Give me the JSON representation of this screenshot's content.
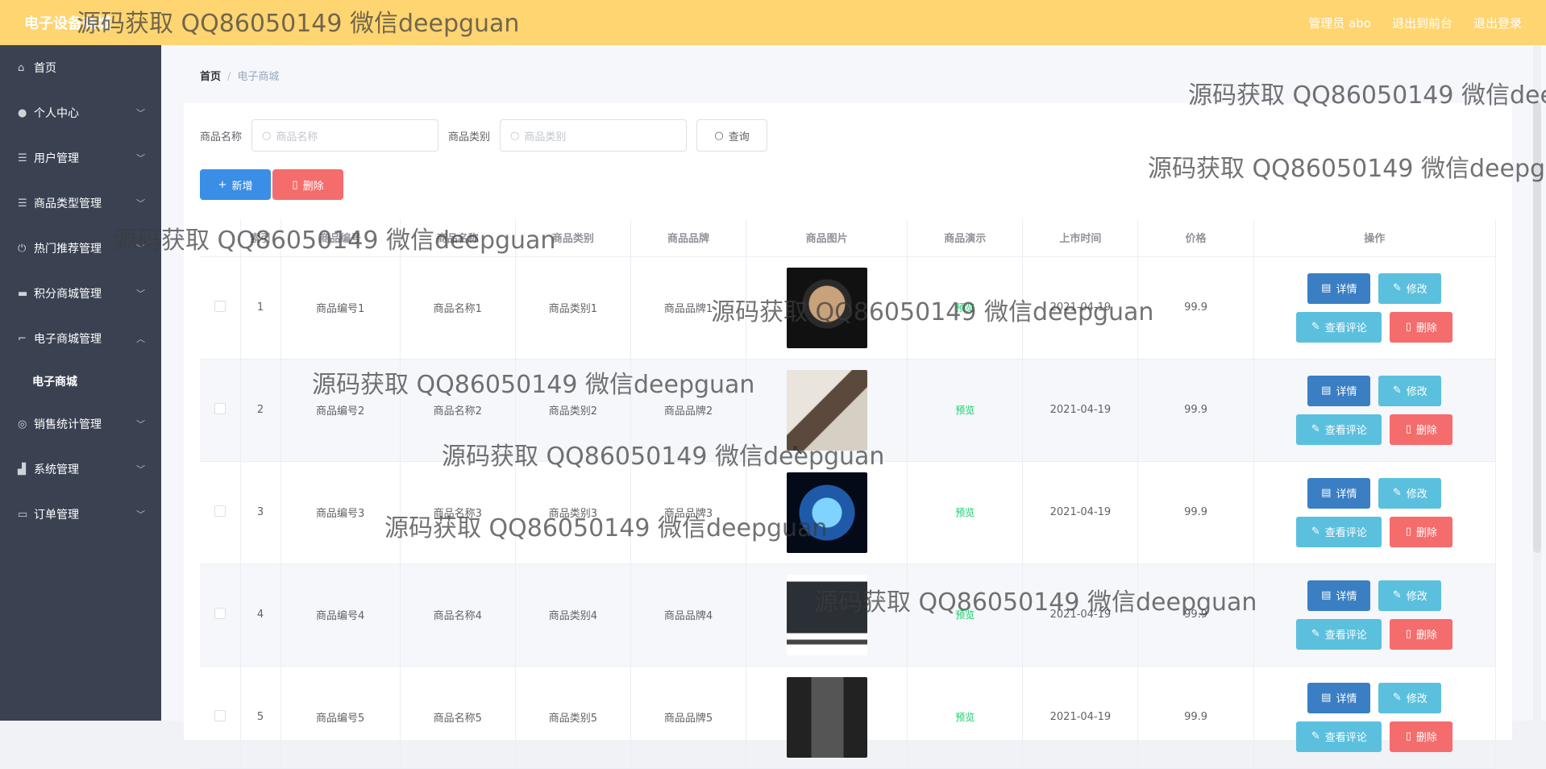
{
  "header": {
    "title": "电子设备商城",
    "admin_label": "管理员 abo",
    "front_link": "退出到前台",
    "logout_link": "退出登录"
  },
  "sidebar": {
    "items": [
      {
        "label": "首页",
        "icon": "home-icon"
      },
      {
        "label": "个人中心",
        "icon": "user-icon"
      },
      {
        "label": "用户管理",
        "icon": "menu-icon"
      },
      {
        "label": "商品类型管理",
        "icon": "menu-icon"
      },
      {
        "label": "热门推荐管理",
        "icon": "power-icon"
      },
      {
        "label": "积分商城管理",
        "icon": "laptop-icon"
      },
      {
        "label": "电子商城管理",
        "icon": "crop-icon"
      },
      {
        "label": "电子商城",
        "icon": ""
      },
      {
        "label": "销售统计管理",
        "icon": "compass-icon"
      },
      {
        "label": "系统管理",
        "icon": "chart-icon"
      },
      {
        "label": "订单管理",
        "icon": "chat-icon"
      }
    ]
  },
  "breadcrumb": {
    "home": "首页",
    "current": "电子商城"
  },
  "search": {
    "name_label": "商品名称",
    "name_placeholder": "商品名称",
    "type_label": "商品类别",
    "type_placeholder": "商品类别",
    "query_button": "查询"
  },
  "actions": {
    "add": "新增",
    "delete": "删除"
  },
  "table": {
    "headers": [
      "",
      "索引",
      "商品编号",
      "商品名称",
      "商品类别",
      "商品品牌",
      "商品图片",
      "商品演示",
      "上市时间",
      "价格",
      "操作"
    ],
    "rows": [
      {
        "index": "1",
        "code": "商品编号1",
        "name": "商品名称1",
        "category": "商品类别1",
        "brand": "商品品牌1",
        "preview": "预览",
        "date": "2021-04-19",
        "price": "99.9"
      },
      {
        "index": "2",
        "code": "商品编号2",
        "name": "商品名称2",
        "category": "商品类别2",
        "brand": "商品品牌2",
        "preview": "预览",
        "date": "2021-04-19",
        "price": "99.9"
      },
      {
        "index": "3",
        "code": "商品编号3",
        "name": "商品名称3",
        "category": "商品类别3",
        "brand": "商品品牌3",
        "preview": "预览",
        "date": "2021-04-19",
        "price": "99.9"
      },
      {
        "index": "4",
        "code": "商品编号4",
        "name": "商品名称4",
        "category": "商品类别4",
        "brand": "商品品牌4",
        "preview": "预览",
        "date": "2021-04-19",
        "price": "99.9"
      },
      {
        "index": "5",
        "code": "商品编号5",
        "name": "商品名称5",
        "category": "商品类别5",
        "brand": "商品品牌5",
        "preview": "预览",
        "date": "2021-04-19",
        "price": "99.9"
      }
    ],
    "row_buttons": {
      "detail": "详情",
      "edit": "修改",
      "review": "查看评论",
      "remove": "删除"
    }
  },
  "watermark": "源码获取 QQ86050149 微信deepguan",
  "colors": {
    "header_bg": "#ffd572",
    "sidebar_bg": "#3a4252",
    "primary": "#3a8ee6",
    "danger": "#f56c6c",
    "info": "#5bc0de",
    "success": "#13ce66"
  }
}
